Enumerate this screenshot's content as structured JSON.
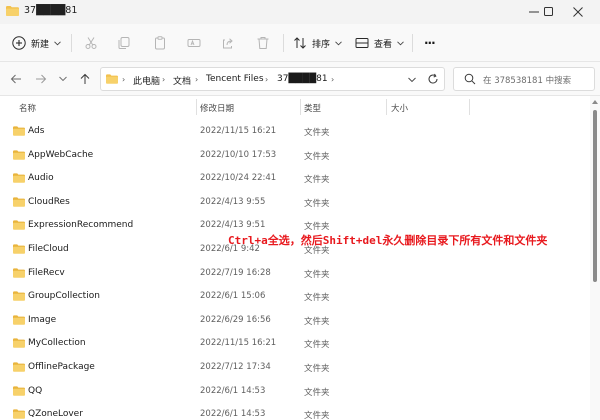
{
  "window": {
    "title": "37████81"
  },
  "toolbar": {
    "new_label": "新建",
    "sort_label": "排序",
    "view_label": "查看",
    "more_label": "···"
  },
  "address": {
    "crumbs": [
      "此电脑",
      "文档",
      "Tencent Files",
      "37████81"
    ],
    "search_placeholder": "在 378538181 中搜索"
  },
  "columns": {
    "name": "名称",
    "date": "修改日期",
    "type": "类型",
    "size": "大小"
  },
  "folders": [
    {
      "name": "Ads",
      "date": "2022/11/15 16:21",
      "type": "文件夹"
    },
    {
      "name": "AppWebCache",
      "date": "2022/10/10 17:53",
      "type": "文件夹"
    },
    {
      "name": "Audio",
      "date": "2022/10/24 22:41",
      "type": "文件夹"
    },
    {
      "name": "CloudRes",
      "date": "2022/4/13 9:55",
      "type": "文件夹"
    },
    {
      "name": "ExpressionRecommend",
      "date": "2022/4/13 9:51",
      "type": "文件夹"
    },
    {
      "name": "FileCloud",
      "date": "2022/6/1 9:42",
      "type": "文件夹"
    },
    {
      "name": "FileRecv",
      "date": "2022/7/19 16:28",
      "type": "文件夹"
    },
    {
      "name": "GroupCollection",
      "date": "2022/6/1 15:06",
      "type": "文件夹"
    },
    {
      "name": "Image",
      "date": "2022/6/29 16:56",
      "type": "文件夹"
    },
    {
      "name": "MyCollection",
      "date": "2022/11/15 16:21",
      "type": "文件夹"
    },
    {
      "name": "OfflinePackage",
      "date": "2022/7/12 17:34",
      "type": "文件夹"
    },
    {
      "name": "QQ",
      "date": "2022/6/1 14:53",
      "type": "文件夹"
    },
    {
      "name": "QZoneLover",
      "date": "2022/6/1 14:53",
      "type": "文件夹"
    }
  ],
  "annotation": {
    "text": "Ctrl+a全选，然后Shift+del永久删除目录下所有文件和文件夹",
    "color": "#e8191e"
  },
  "colors": {
    "folder": "#f2c14e",
    "accent": "#0067c0"
  }
}
